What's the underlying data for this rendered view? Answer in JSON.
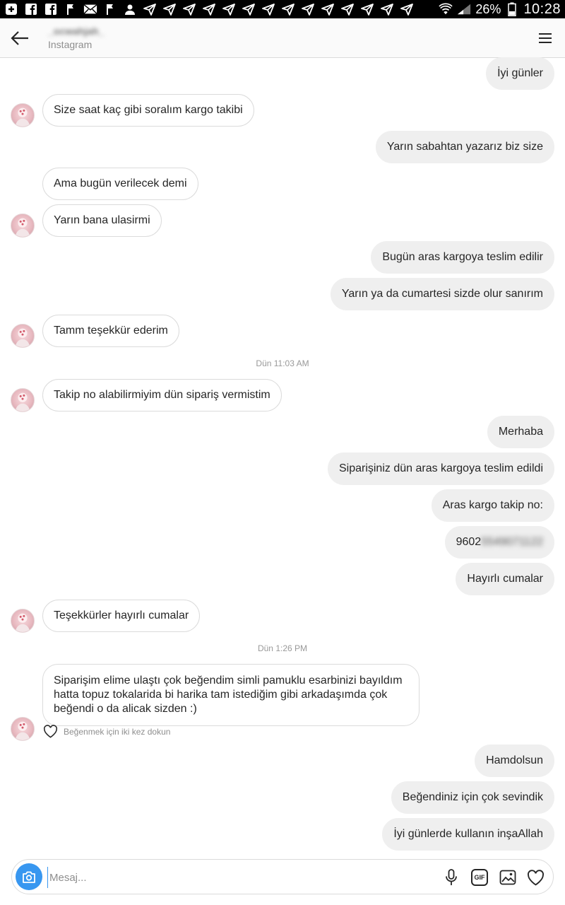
{
  "status_bar": {
    "battery": "26%",
    "time": "10:28",
    "icons": [
      "add-box-icon",
      "facebook-icon",
      "facebook-icon",
      "flag-icon",
      "mail-icon",
      "flag-icon",
      "person-icon",
      "send-icon",
      "send-icon",
      "send-icon",
      "send-icon",
      "send-icon",
      "send-icon",
      "send-icon",
      "send-icon",
      "send-icon",
      "send-icon",
      "send-icon",
      "send-icon",
      "send-icon",
      "send-icon",
      "send-icon",
      "wifi-icon",
      "signal-icon",
      "battery-icon"
    ]
  },
  "header": {
    "name": "_ocwahjah_",
    "subtitle": "Instagram"
  },
  "messages": [
    {
      "dir": "out",
      "text": "İyi günler"
    },
    {
      "dir": "in",
      "text": "Size saat kaç gibi soralım kargo takibi"
    },
    {
      "dir": "out",
      "text": "Yarın sabahtan yazarız biz size"
    },
    {
      "dir": "in",
      "text": "Ama bugün verilecek demi"
    },
    {
      "dir": "in",
      "text": "Yarın bana ulasirmi"
    },
    {
      "dir": "out",
      "text": "Bugün aras kargoya teslim edilir"
    },
    {
      "dir": "out",
      "text": "Yarın ya da cumartesi sizde olur sanırım"
    },
    {
      "dir": "in",
      "text": "Tamm teşekkür ederim"
    },
    {
      "dir": "in",
      "text": "Takip no alabilirmiyim dün sipariş vermistim"
    },
    {
      "dir": "out",
      "text": "Merhaba"
    },
    {
      "dir": "out",
      "text": "Siparişiniz dün aras kargoya teslim edildi"
    },
    {
      "dir": "out",
      "text": "Aras kargo takip no:"
    },
    {
      "dir": "out",
      "text": "9602",
      "hidden": "5549071122"
    },
    {
      "dir": "out",
      "text": "Hayırlı cumalar"
    },
    {
      "dir": "in",
      "text": "Teşekkürler hayırlı cumalar"
    },
    {
      "dir": "in",
      "text": "Siparişim elime ulaştı çok beğendim simli pamuklu esarbinizi bayıldım hatta topuz tokalarida bi harika tam istediğim gibi arkadaşımda çok beğendi o da alicak sizden :)"
    },
    {
      "dir": "out",
      "text": "Hamdolsun"
    },
    {
      "dir": "out",
      "text": "Beğendiniz için çok sevindik"
    },
    {
      "dir": "out",
      "text": "İyi günlerde kullanın inşaAllah"
    }
  ],
  "timestamps": [
    "Dün 11:03 AM",
    "Dün 1:26 PM"
  ],
  "like_hint": "Beğenmek için iki kez dokun",
  "composer": {
    "placeholder": "Mesaj...",
    "gif_label": "GIF"
  }
}
